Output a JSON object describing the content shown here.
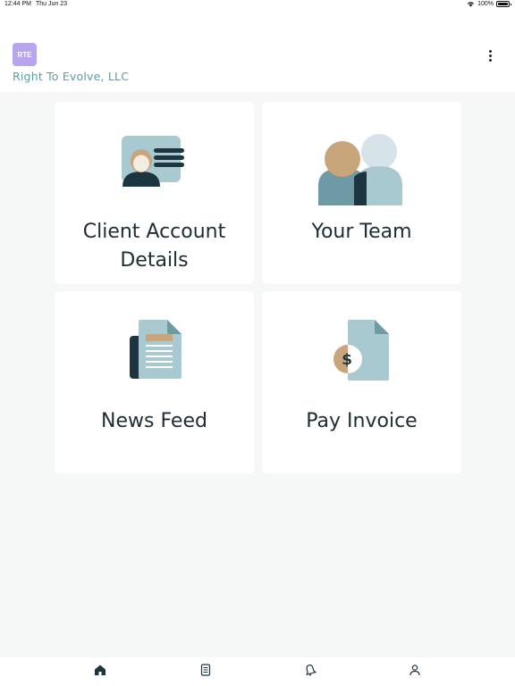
{
  "status_bar": {
    "time": "12:44 PM",
    "date": "Thu Jun 23",
    "battery": "100%"
  },
  "header": {
    "logo_text": "RTE",
    "company_name": "Right To Evolve, LLC",
    "menu_icon": "more-vertical-icon"
  },
  "cards": [
    {
      "title_line1": "Client Account",
      "title_line2": "Details",
      "icon": "id-card-icon"
    },
    {
      "title": "Your Team",
      "icon": "team-icon"
    },
    {
      "title": "News Feed",
      "icon": "newspaper-icon"
    },
    {
      "title": "Pay Invoice",
      "icon": "invoice-dollar-icon"
    }
  ],
  "tab_bar": {
    "items": [
      {
        "icon": "home-icon",
        "active": true
      },
      {
        "icon": "document-icon",
        "active": false
      },
      {
        "icon": "bell-icon",
        "active": false
      },
      {
        "icon": "person-icon",
        "active": false
      }
    ]
  },
  "colors": {
    "accent_teal": "#5a9ea7",
    "dark_navy": "#1c3540",
    "light_blue": "#a9c9d0",
    "tan": "#c9a57c",
    "logo_purple": "#b9a4ee"
  }
}
